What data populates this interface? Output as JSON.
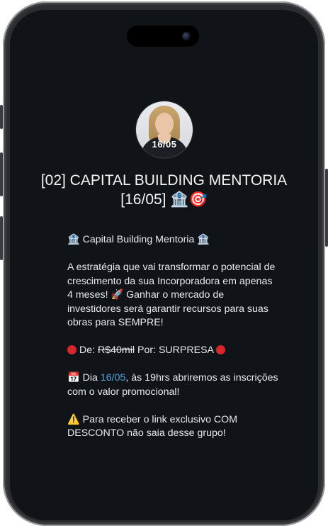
{
  "avatar": {
    "overlay_text": "16/05",
    "icon": "profile-photo"
  },
  "group": {
    "title": "[02] CAPITAL BUILDING MENTORIA [16/05]",
    "title_emojis": [
      "🏦",
      "🎯"
    ]
  },
  "description": {
    "heading": "Capital Building Mentoria",
    "heading_emoji": "🏦",
    "paragraph1": "A estratégia que vai transformar o potencial de crescimento da sua Incorporadora em apenas 4 meses! 🚀 Ganhar o mercado de investidores será garantir recursos para suas obras para SEMPRE!",
    "price_prefix": "De:",
    "price_old": "R$40mil",
    "price_now_label": "Por:",
    "price_now": "SURPRESA",
    "date_emoji": "📅",
    "date_prefix": "Dia",
    "date_value": "16/05",
    "date_suffix": ", às 19hrs abriremos as inscrições com o valor promocional!",
    "warning_emoji": "⚠️",
    "warning_text": "Para receber o link exclusivo COM DESCONTO não saia desse grupo!"
  },
  "colors": {
    "screen_bg": "#101418",
    "text": "#e8eaed",
    "link": "#4fa3e0",
    "red_dot": "#d8262d"
  }
}
